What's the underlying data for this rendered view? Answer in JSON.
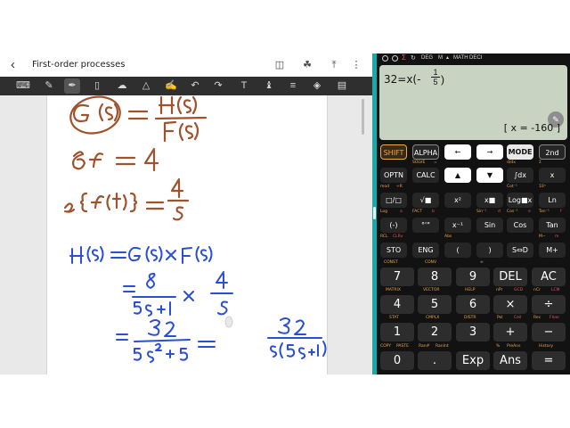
{
  "notes_app": {
    "title": "First-order processes",
    "back_icon": "chevron-left-icon",
    "header_icons": [
      "book-icon",
      "tag-icon",
      "share-icon",
      "more-vert-icon"
    ],
    "tools": [
      "keyboard-icon",
      "pen-icon",
      "highlighter-icon",
      "eraser-icon",
      "lasso-icon",
      "shape-icon",
      "pen-edit-icon",
      "undo-icon",
      "redo-icon",
      "text-icon",
      "brush-icon",
      "insert-icon",
      "paint-icon",
      "document-icon"
    ],
    "active_tool": "highlighter-icon",
    "ink_colors": {
      "brown": "#a0522d",
      "blue": "#2a4fd4"
    },
    "handwritten_lines": [
      "G(s) = H(s) / F(s)",
      "δf = 4",
      "L{f(t)} = 4/s",
      "H(s) = G(s) x F(s)",
      "= 8/(5s+1) x 4/s",
      "= 32/(5s² + s) = 32/(s(5s+1))"
    ]
  },
  "calculator": {
    "status_items": [
      "DEG",
      "M",
      "MATH",
      "DECI"
    ],
    "expression": "32=x(-",
    "frac_num": "1",
    "frac_den": "5",
    "expression_close": ")",
    "result": "[ x = -160 ]",
    "rows": [
      {
        "keys": [
          "SHIFT",
          "ALPHA",
          "←",
          "→",
          "MODE",
          "2nd"
        ]
      },
      {
        "keys": [
          "OPTN",
          "CALC",
          "▲",
          "▼",
          "∫dx",
          "x"
        ]
      },
      {
        "keys": [
          "□/□",
          "√■",
          "x²",
          "x■",
          "Log■x",
          "Ln"
        ]
      },
      {
        "keys": [
          "(-)",
          "°'\"",
          "x⁻¹",
          "Sin",
          "Cos",
          "Tan"
        ]
      },
      {
        "keys": [
          "STO",
          "ENG",
          "(",
          ")",
          "S⇔D",
          "M+"
        ]
      },
      {
        "keys": [
          "7",
          "8",
          "9",
          "DEL",
          "AC"
        ]
      },
      {
        "keys": [
          "4",
          "5",
          "6",
          "×",
          "÷"
        ]
      },
      {
        "keys": [
          "1",
          "2",
          "3",
          "+",
          "−"
        ]
      },
      {
        "keys": [
          "0",
          ".",
          "Exp",
          "Ans",
          "="
        ]
      }
    ],
    "sublabels": {
      "r0": [
        "SOLVE",
        "=",
        "",
        "",
        "d/dx",
        "Σ"
      ],
      "r1": [
        "mod",
        "÷R",
        "",
        "",
        "Cot⁻¹",
        "10ˣ"
      ],
      "r2": [
        "Log",
        "a",
        "FACT",
        "b",
        "Sin⁻¹",
        "d",
        "Cos⁻¹",
        "e",
        "Tan⁻¹",
        "f"
      ],
      "r3": [
        "RCL",
        "CLRv",
        "",
        "",
        "Abs",
        "",
        "",
        "",
        "M−",
        "m"
      ],
      "r4": [
        "CONST",
        "",
        "CONV",
        "",
        "∞"
      ],
      "r5": [
        "MATRIX",
        "VECTOR",
        "HELP",
        "nPr",
        "GCD",
        "nCr",
        "LCM"
      ],
      "r6": [
        "STAT",
        "CMPLX",
        "DISTR",
        "Pol",
        "Ceil",
        "Rec",
        "Floor"
      ],
      "r7": [
        "COPY",
        "PASTE",
        "Ran#",
        "RanInt",
        "%",
        "PreAns",
        "History"
      ]
    },
    "accent_colors": {
      "shift": "#f0a54a",
      "label_red": "#e25c5c",
      "display_bg": "#c9d3c2"
    }
  }
}
